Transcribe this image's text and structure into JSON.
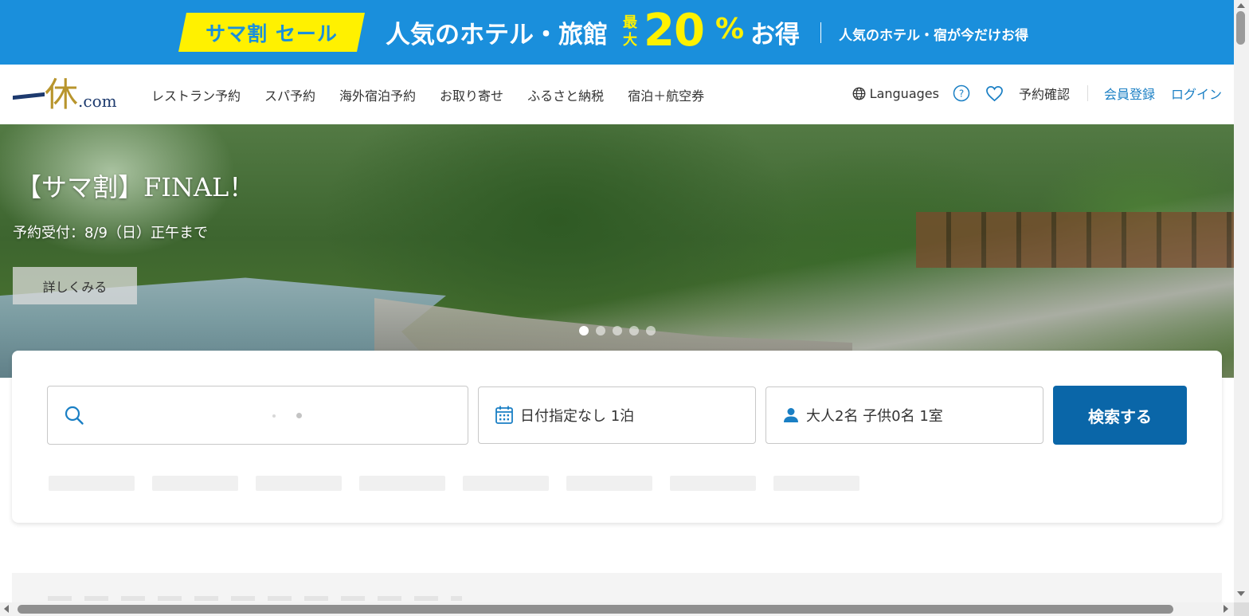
{
  "promo": {
    "tag": "サマ割 セール",
    "main": "人気のホテル・旅館",
    "max_label": "最大",
    "percent_value": "20",
    "percent_sign": "%",
    "otoku": "お得",
    "sub": "人気のホテル・宿が今だけお得",
    "colors": {
      "background": "#1a8fdc",
      "accent": "#fff100"
    }
  },
  "header": {
    "logo": {
      "mark": "休",
      "suffix": ".com"
    },
    "nav": [
      {
        "label": "レストラン予約"
      },
      {
        "label": "スパ予約"
      },
      {
        "label": "海外宿泊予約"
      },
      {
        "label": "お取り寄せ"
      },
      {
        "label": "ふるさと納税"
      },
      {
        "label": "宿泊＋航空券"
      }
    ],
    "languages": "Languages",
    "help_icon": "question-circle-icon",
    "favorite_icon": "heart-icon",
    "reservation_check": "予約確認",
    "register": "会員登録",
    "login": "ログイン"
  },
  "hero": {
    "title": "【サマ割】FINAL！",
    "subtitle": "予約受付：8/9（日）正午まで",
    "detail_button": "詳しくみる",
    "slide_count": 5,
    "active_slide": 1
  },
  "search": {
    "keyword_value": "",
    "keyword_icon": "search-icon",
    "date_icon": "calendar-icon",
    "date_label": "日付指定なし 1泊",
    "guests_icon": "person-icon",
    "guests_label": "大人2名 子供0名 1室",
    "submit": "検索する",
    "submit_color": "#0a66a8",
    "icon_color": "#1a7fc4"
  }
}
